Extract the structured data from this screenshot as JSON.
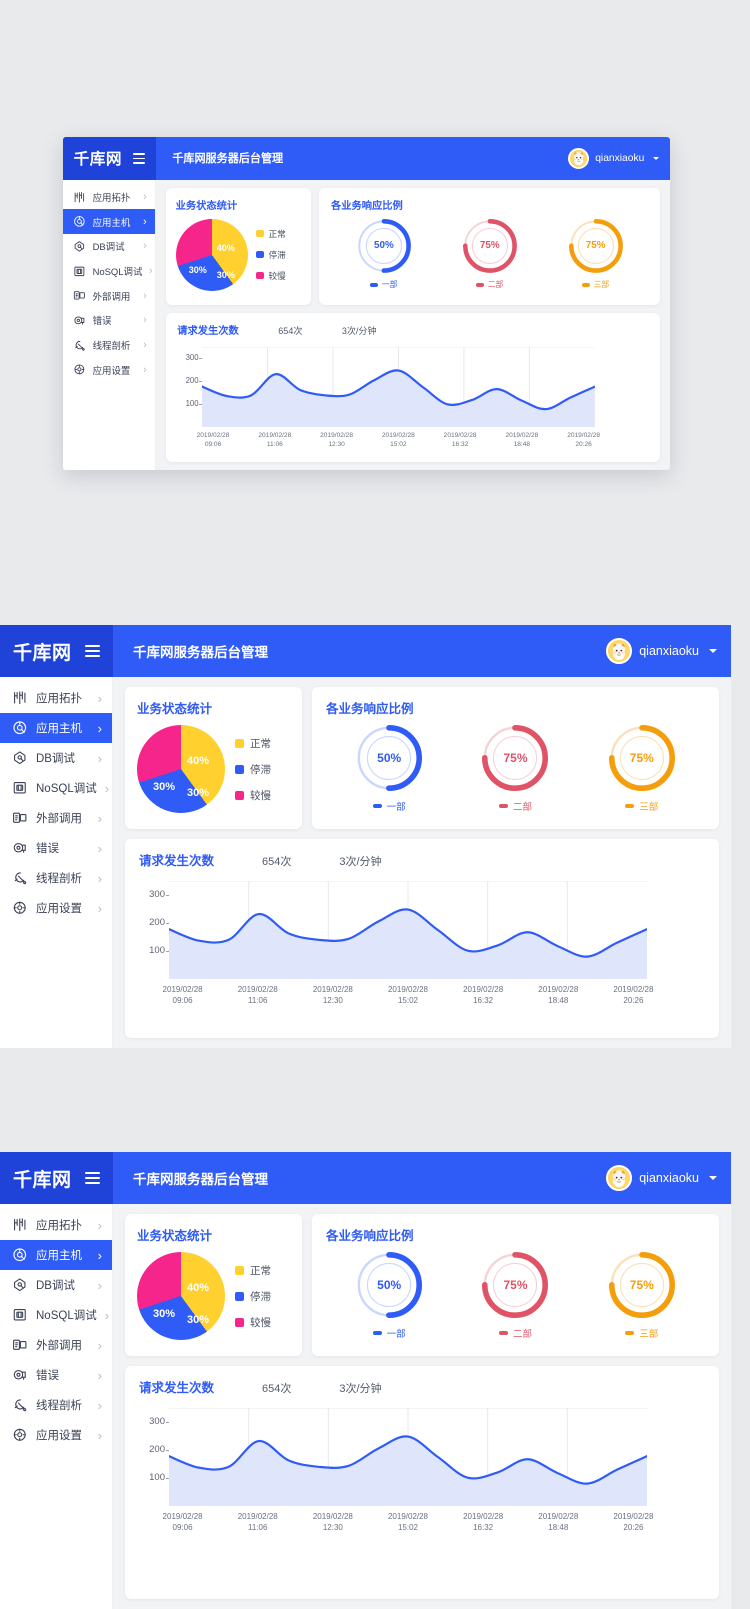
{
  "brand": {
    "logo_text": "千库网",
    "menu_icon": "hamburger-icon"
  },
  "header": {
    "title": "千库网服务器后台管理",
    "user_name": "qianxiaoku",
    "avatar_icon": "user-avatar",
    "caret_icon": "chevron-down-icon"
  },
  "sidebar": {
    "items": [
      {
        "label": "应用拓扑",
        "icon": "topology-icon",
        "arrow": "›",
        "active": false
      },
      {
        "label": "应用主机",
        "icon": "host-icon",
        "arrow": "›",
        "active": true
      },
      {
        "label": "DB调试",
        "icon": "database-icon",
        "arrow": "›",
        "active": false
      },
      {
        "label": "NoSQL调试",
        "icon": "nosql-icon",
        "arrow": "›",
        "active": false
      },
      {
        "label": "外部调用",
        "icon": "external-icon",
        "arrow": "›",
        "active": false
      },
      {
        "label": "错误",
        "icon": "error-icon",
        "arrow": "›",
        "active": false
      },
      {
        "label": "线程剖析",
        "icon": "thread-icon",
        "arrow": "›",
        "active": false
      },
      {
        "label": "应用设置",
        "icon": "settings-icon",
        "arrow": "›",
        "active": false
      }
    ]
  },
  "pie_card": {
    "title": "业务状态统计",
    "chart_data": {
      "type": "pie",
      "title": "业务状态统计",
      "categories": [
        "正常",
        "停滞",
        "较慢"
      ],
      "values": [
        40,
        30,
        30
      ],
      "labels": [
        "40%",
        "30%",
        "30%"
      ],
      "colors": [
        "#ffd02e",
        "#2f5bf6",
        "#f5258c"
      ],
      "legend_position": "right"
    },
    "legend": [
      {
        "label": "正常",
        "color": "#ffd02e"
      },
      {
        "label": "停滞",
        "color": "#2f5bf6"
      },
      {
        "label": "较慢",
        "color": "#f5258c"
      }
    ],
    "slice_labels": [
      "40%",
      "30%",
      "30%"
    ]
  },
  "ring_card": {
    "title": "各业务响应比例",
    "chart_data": {
      "type": "pie",
      "title": "各业务响应比例",
      "categories": [
        "一部",
        "二部",
        "三部"
      ],
      "values": [
        50,
        75,
        75
      ],
      "labels": [
        "50%",
        "75%",
        "75%"
      ],
      "colors": [
        "#2f5bf6",
        "#e05367",
        "#f59e0b"
      ]
    },
    "rings": [
      {
        "label": "一部",
        "value": "50%",
        "percent": 50,
        "color": "#2f5bf6",
        "track": "#c9d6ff"
      },
      {
        "label": "二部",
        "value": "75%",
        "percent": 75,
        "color": "#e05367",
        "track": "#f6d2d7"
      },
      {
        "label": "三部",
        "value": "75%",
        "percent": 75,
        "color": "#f59e0b",
        "track": "#fae1b8"
      }
    ]
  },
  "line_card": {
    "title": "请求发生次数",
    "stat_total": "654次",
    "stat_rate": "3次/分钟",
    "chart_data": {
      "type": "area",
      "title": "请求发生次数",
      "ylabel": "",
      "xlabel": "",
      "ylim": [
        0,
        350
      ],
      "yticks": [
        100,
        200,
        300
      ],
      "ytick_labels": [
        "100",
        "200",
        "300"
      ],
      "grid": true,
      "line_color": "#2f5bf6",
      "fill_color": "#dfe5fb",
      "x": [
        "2019/02/28 09:06",
        "2019/02/28 11:06",
        "2019/02/28 12:30",
        "2019/02/28 15:02",
        "2019/02/28 16:32",
        "2019/02/28 18:48",
        "2019/02/28 20:26"
      ],
      "series": [
        {
          "name": "请求发生次数",
          "values": [
            178,
            137,
            140,
            232,
            163,
            140,
            143,
            205,
            248,
            175,
            101,
            120,
            167,
            118,
            80,
            130,
            178
          ]
        }
      ]
    },
    "y_ticks": [
      "300",
      "200",
      "100"
    ],
    "x_labels": [
      {
        "date": "2019/02/28",
        "time": "09:06"
      },
      {
        "date": "2019/02/28",
        "time": "11:06"
      },
      {
        "date": "2019/02/28",
        "time": "12:30"
      },
      {
        "date": "2019/02/28",
        "time": "15:02"
      },
      {
        "date": "2019/02/28",
        "time": "16:32"
      },
      {
        "date": "2019/02/28",
        "time": "18:48"
      },
      {
        "date": "2019/02/28",
        "time": "20:26"
      }
    ]
  },
  "colors": {
    "primary": "#2f5bf6",
    "primary_dark": "#1f42d8",
    "page_bg": "#e9eaec",
    "content_bg": "#f2f3f5",
    "yellow": "#ffd02e",
    "pink": "#f5258c",
    "red": "#e05367",
    "orange": "#f59e0b"
  }
}
